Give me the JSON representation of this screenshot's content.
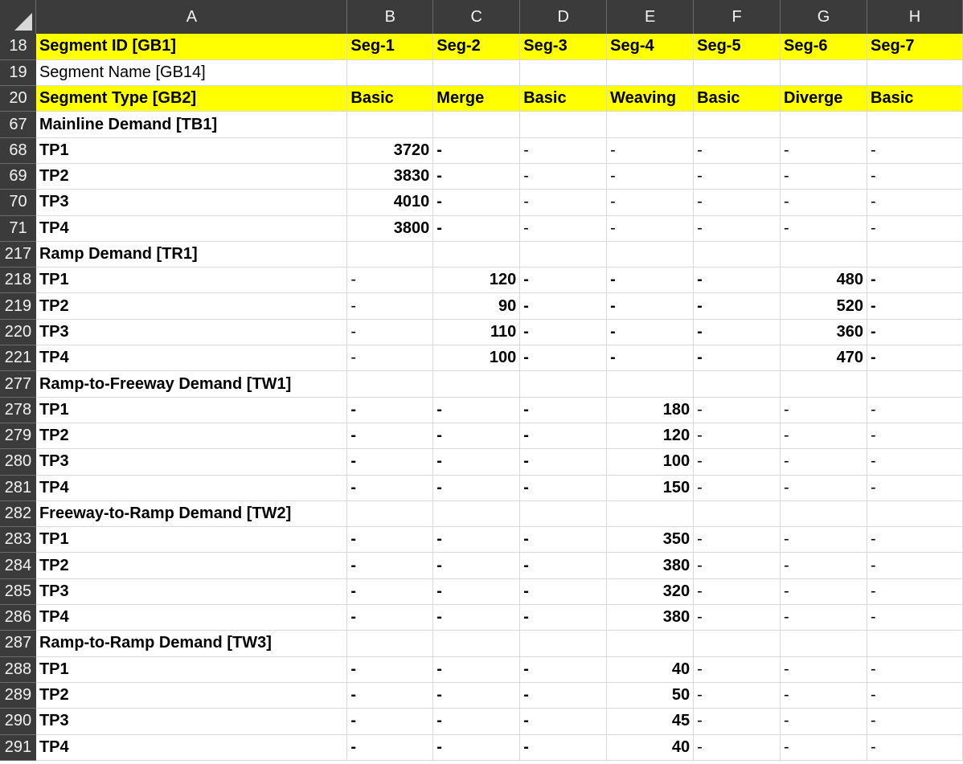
{
  "columns": [
    "A",
    "B",
    "C",
    "D",
    "E",
    "F",
    "G",
    "H"
  ],
  "rows": [
    {
      "num": "18",
      "style": "header",
      "cells": [
        {
          "v": "Segment ID [GB1]",
          "b": 1
        },
        {
          "v": "Seg-1",
          "b": 1
        },
        {
          "v": "Seg-2",
          "b": 1
        },
        {
          "v": "Seg-3",
          "b": 1
        },
        {
          "v": "Seg-4",
          "b": 1
        },
        {
          "v": "Seg-5",
          "b": 1
        },
        {
          "v": "Seg-6",
          "b": 1
        },
        {
          "v": "Seg-7",
          "b": 1
        }
      ]
    },
    {
      "num": "19",
      "style": "plain",
      "cells": [
        {
          "v": "Segment Name [GB14]",
          "b": 0
        },
        {
          "v": ""
        },
        {
          "v": ""
        },
        {
          "v": ""
        },
        {
          "v": ""
        },
        {
          "v": ""
        },
        {
          "v": ""
        },
        {
          "v": ""
        }
      ]
    },
    {
      "num": "20",
      "style": "header",
      "cells": [
        {
          "v": "Segment Type [GB2]",
          "b": 1
        },
        {
          "v": "Basic",
          "b": 1
        },
        {
          "v": "Merge",
          "b": 1
        },
        {
          "v": "Basic",
          "b": 1
        },
        {
          "v": "Weaving",
          "b": 1
        },
        {
          "v": "Basic",
          "b": 1
        },
        {
          "v": "Diverge",
          "b": 1
        },
        {
          "v": "Basic",
          "b": 1
        }
      ]
    },
    {
      "num": "67",
      "style": "plain",
      "cells": [
        {
          "v": "Mainline Demand [TB1]",
          "b": 1
        },
        {
          "v": ""
        },
        {
          "v": ""
        },
        {
          "v": ""
        },
        {
          "v": ""
        },
        {
          "v": ""
        },
        {
          "v": ""
        },
        {
          "v": ""
        }
      ]
    },
    {
      "num": "68",
      "style": "plain",
      "cells": [
        {
          "v": "TP1",
          "b": 1
        },
        {
          "v": "3720",
          "b": 1,
          "r": 1
        },
        {
          "v": "-",
          "b": 1
        },
        {
          "v": "-"
        },
        {
          "v": "-"
        },
        {
          "v": "-"
        },
        {
          "v": "-"
        },
        {
          "v": "-"
        }
      ]
    },
    {
      "num": "69",
      "style": "plain",
      "cells": [
        {
          "v": "TP2",
          "b": 1
        },
        {
          "v": "3830",
          "b": 1,
          "r": 1
        },
        {
          "v": "-",
          "b": 1
        },
        {
          "v": "-"
        },
        {
          "v": "-"
        },
        {
          "v": "-"
        },
        {
          "v": "-"
        },
        {
          "v": "-"
        }
      ]
    },
    {
      "num": "70",
      "style": "plain",
      "cells": [
        {
          "v": "TP3",
          "b": 1
        },
        {
          "v": "4010",
          "b": 1,
          "r": 1
        },
        {
          "v": "-",
          "b": 1
        },
        {
          "v": "-"
        },
        {
          "v": "-"
        },
        {
          "v": "-"
        },
        {
          "v": "-"
        },
        {
          "v": "-"
        }
      ]
    },
    {
      "num": "71",
      "style": "plain",
      "cells": [
        {
          "v": "TP4",
          "b": 1
        },
        {
          "v": "3800",
          "b": 1,
          "r": 1
        },
        {
          "v": "-",
          "b": 1
        },
        {
          "v": "-"
        },
        {
          "v": "-"
        },
        {
          "v": "-"
        },
        {
          "v": "-"
        },
        {
          "v": "-"
        }
      ]
    },
    {
      "num": "217",
      "style": "plain",
      "cells": [
        {
          "v": "Ramp Demand [TR1]",
          "b": 1
        },
        {
          "v": ""
        },
        {
          "v": ""
        },
        {
          "v": ""
        },
        {
          "v": ""
        },
        {
          "v": ""
        },
        {
          "v": ""
        },
        {
          "v": ""
        }
      ]
    },
    {
      "num": "218",
      "style": "plain",
      "cells": [
        {
          "v": "TP1",
          "b": 1
        },
        {
          "v": "-"
        },
        {
          "v": "120",
          "b": 1,
          "r": 1
        },
        {
          "v": "-",
          "b": 1
        },
        {
          "v": "-",
          "b": 1
        },
        {
          "v": "-",
          "b": 1
        },
        {
          "v": "480",
          "b": 1,
          "r": 1
        },
        {
          "v": "-",
          "b": 1
        }
      ]
    },
    {
      "num": "219",
      "style": "plain",
      "cells": [
        {
          "v": "TP2",
          "b": 1
        },
        {
          "v": "-"
        },
        {
          "v": "90",
          "b": 1,
          "r": 1
        },
        {
          "v": "-",
          "b": 1
        },
        {
          "v": "-",
          "b": 1
        },
        {
          "v": "-",
          "b": 1
        },
        {
          "v": "520",
          "b": 1,
          "r": 1
        },
        {
          "v": "-",
          "b": 1
        }
      ]
    },
    {
      "num": "220",
      "style": "plain",
      "cells": [
        {
          "v": "TP3",
          "b": 1
        },
        {
          "v": "-"
        },
        {
          "v": "110",
          "b": 1,
          "r": 1
        },
        {
          "v": "-",
          "b": 1
        },
        {
          "v": "-",
          "b": 1
        },
        {
          "v": "-",
          "b": 1
        },
        {
          "v": "360",
          "b": 1,
          "r": 1
        },
        {
          "v": "-",
          "b": 1
        }
      ]
    },
    {
      "num": "221",
      "style": "plain",
      "cells": [
        {
          "v": "TP4",
          "b": 1
        },
        {
          "v": "-"
        },
        {
          "v": "100",
          "b": 1,
          "r": 1
        },
        {
          "v": "-",
          "b": 1
        },
        {
          "v": "-",
          "b": 1
        },
        {
          "v": "-",
          "b": 1
        },
        {
          "v": "470",
          "b": 1,
          "r": 1
        },
        {
          "v": "-",
          "b": 1
        }
      ]
    },
    {
      "num": "277",
      "style": "plain",
      "cells": [
        {
          "v": "Ramp-to-Freeway Demand [TW1]",
          "b": 1
        },
        {
          "v": ""
        },
        {
          "v": ""
        },
        {
          "v": ""
        },
        {
          "v": ""
        },
        {
          "v": ""
        },
        {
          "v": ""
        },
        {
          "v": ""
        }
      ]
    },
    {
      "num": "278",
      "style": "plain",
      "cells": [
        {
          "v": "TP1",
          "b": 1
        },
        {
          "v": "-",
          "b": 1
        },
        {
          "v": "-",
          "b": 1
        },
        {
          "v": "-",
          "b": 1
        },
        {
          "v": "180",
          "b": 1,
          "r": 1
        },
        {
          "v": "-"
        },
        {
          "v": "-"
        },
        {
          "v": "-"
        }
      ]
    },
    {
      "num": "279",
      "style": "plain",
      "cells": [
        {
          "v": "TP2",
          "b": 1
        },
        {
          "v": "-",
          "b": 1
        },
        {
          "v": "-",
          "b": 1
        },
        {
          "v": "-",
          "b": 1
        },
        {
          "v": "120",
          "b": 1,
          "r": 1
        },
        {
          "v": "-"
        },
        {
          "v": "-"
        },
        {
          "v": "-"
        }
      ]
    },
    {
      "num": "280",
      "style": "plain",
      "cells": [
        {
          "v": "TP3",
          "b": 1
        },
        {
          "v": "-",
          "b": 1
        },
        {
          "v": "-",
          "b": 1
        },
        {
          "v": "-",
          "b": 1
        },
        {
          "v": "100",
          "b": 1,
          "r": 1
        },
        {
          "v": "-"
        },
        {
          "v": "-"
        },
        {
          "v": "-"
        }
      ]
    },
    {
      "num": "281",
      "style": "plain",
      "cells": [
        {
          "v": "TP4",
          "b": 1
        },
        {
          "v": "-",
          "b": 1
        },
        {
          "v": "-",
          "b": 1
        },
        {
          "v": "-",
          "b": 1
        },
        {
          "v": "150",
          "b": 1,
          "r": 1
        },
        {
          "v": "-"
        },
        {
          "v": "-"
        },
        {
          "v": "-"
        }
      ]
    },
    {
      "num": "282",
      "style": "plain",
      "cells": [
        {
          "v": "Freeway-to-Ramp Demand [TW2]",
          "b": 1
        },
        {
          "v": ""
        },
        {
          "v": ""
        },
        {
          "v": ""
        },
        {
          "v": ""
        },
        {
          "v": ""
        },
        {
          "v": ""
        },
        {
          "v": ""
        }
      ]
    },
    {
      "num": "283",
      "style": "plain",
      "cells": [
        {
          "v": "TP1",
          "b": 1
        },
        {
          "v": "-",
          "b": 1
        },
        {
          "v": "-",
          "b": 1
        },
        {
          "v": "-",
          "b": 1
        },
        {
          "v": "350",
          "b": 1,
          "r": 1
        },
        {
          "v": "-"
        },
        {
          "v": "-"
        },
        {
          "v": "-"
        }
      ]
    },
    {
      "num": "284",
      "style": "plain",
      "cells": [
        {
          "v": "TP2",
          "b": 1
        },
        {
          "v": "-",
          "b": 1
        },
        {
          "v": "-",
          "b": 1
        },
        {
          "v": "-",
          "b": 1
        },
        {
          "v": "380",
          "b": 1,
          "r": 1
        },
        {
          "v": "-"
        },
        {
          "v": "-"
        },
        {
          "v": "-"
        }
      ]
    },
    {
      "num": "285",
      "style": "plain",
      "cells": [
        {
          "v": "TP3",
          "b": 1
        },
        {
          "v": "-",
          "b": 1
        },
        {
          "v": "-",
          "b": 1
        },
        {
          "v": "-",
          "b": 1
        },
        {
          "v": "320",
          "b": 1,
          "r": 1
        },
        {
          "v": "-"
        },
        {
          "v": "-"
        },
        {
          "v": "-"
        }
      ]
    },
    {
      "num": "286",
      "style": "plain",
      "cells": [
        {
          "v": "TP4",
          "b": 1
        },
        {
          "v": "-",
          "b": 1
        },
        {
          "v": "-",
          "b": 1
        },
        {
          "v": "-",
          "b": 1
        },
        {
          "v": "380",
          "b": 1,
          "r": 1
        },
        {
          "v": "-"
        },
        {
          "v": "-"
        },
        {
          "v": "-"
        }
      ]
    },
    {
      "num": "287",
      "style": "plain",
      "cells": [
        {
          "v": "Ramp-to-Ramp Demand [TW3]",
          "b": 1
        },
        {
          "v": ""
        },
        {
          "v": ""
        },
        {
          "v": ""
        },
        {
          "v": ""
        },
        {
          "v": ""
        },
        {
          "v": ""
        },
        {
          "v": ""
        }
      ]
    },
    {
      "num": "288",
      "style": "plain",
      "cells": [
        {
          "v": "TP1",
          "b": 1
        },
        {
          "v": "-",
          "b": 1
        },
        {
          "v": "-",
          "b": 1
        },
        {
          "v": "-",
          "b": 1
        },
        {
          "v": "40",
          "b": 1,
          "r": 1
        },
        {
          "v": "-"
        },
        {
          "v": "-"
        },
        {
          "v": "-"
        }
      ]
    },
    {
      "num": "289",
      "style": "plain",
      "cells": [
        {
          "v": "TP2",
          "b": 1
        },
        {
          "v": "-",
          "b": 1
        },
        {
          "v": "-",
          "b": 1
        },
        {
          "v": "-",
          "b": 1
        },
        {
          "v": "50",
          "b": 1,
          "r": 1
        },
        {
          "v": "-"
        },
        {
          "v": "-"
        },
        {
          "v": "-"
        }
      ]
    },
    {
      "num": "290",
      "style": "plain",
      "cells": [
        {
          "v": "TP3",
          "b": 1
        },
        {
          "v": "-",
          "b": 1
        },
        {
          "v": "-",
          "b": 1
        },
        {
          "v": "-",
          "b": 1
        },
        {
          "v": "45",
          "b": 1,
          "r": 1
        },
        {
          "v": "-"
        },
        {
          "v": "-"
        },
        {
          "v": "-"
        }
      ]
    },
    {
      "num": "291",
      "style": "plain",
      "cells": [
        {
          "v": "TP4",
          "b": 1
        },
        {
          "v": "-",
          "b": 1
        },
        {
          "v": "-",
          "b": 1
        },
        {
          "v": "-",
          "b": 1
        },
        {
          "v": "40",
          "b": 1,
          "r": 1
        },
        {
          "v": "-"
        },
        {
          "v": "-"
        },
        {
          "v": "-"
        }
      ]
    }
  ],
  "colors": {
    "header_bg": "#3b3b3b",
    "highlight": "#ffff00",
    "gridline": "#d9d9d9"
  }
}
